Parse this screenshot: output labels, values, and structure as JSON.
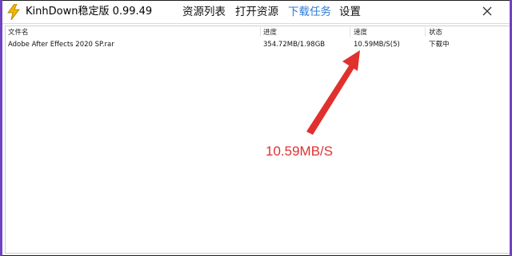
{
  "window": {
    "title": "KinhDown稳定版 0.99.49",
    "icon": "lightning-bolt-icon",
    "close_icon": "close-icon"
  },
  "nav": {
    "items": [
      {
        "label": "资源列表"
      },
      {
        "label": "打开资源"
      },
      {
        "label": "下载任务",
        "active": true
      },
      {
        "label": "设置"
      }
    ],
    "active_color": "#2f7bd8"
  },
  "task_list": {
    "columns": [
      "文件名",
      "进度",
      "速度",
      "状态"
    ],
    "rows": [
      {
        "filename": "Adobe After Effects 2020 SP.rar",
        "progress": "354.72MB/1.98GB",
        "speed": "10.59MB/S(5)",
        "status": "下载中"
      }
    ]
  },
  "annotation": {
    "text": "10.59MB/S",
    "color": "#e0312f"
  }
}
